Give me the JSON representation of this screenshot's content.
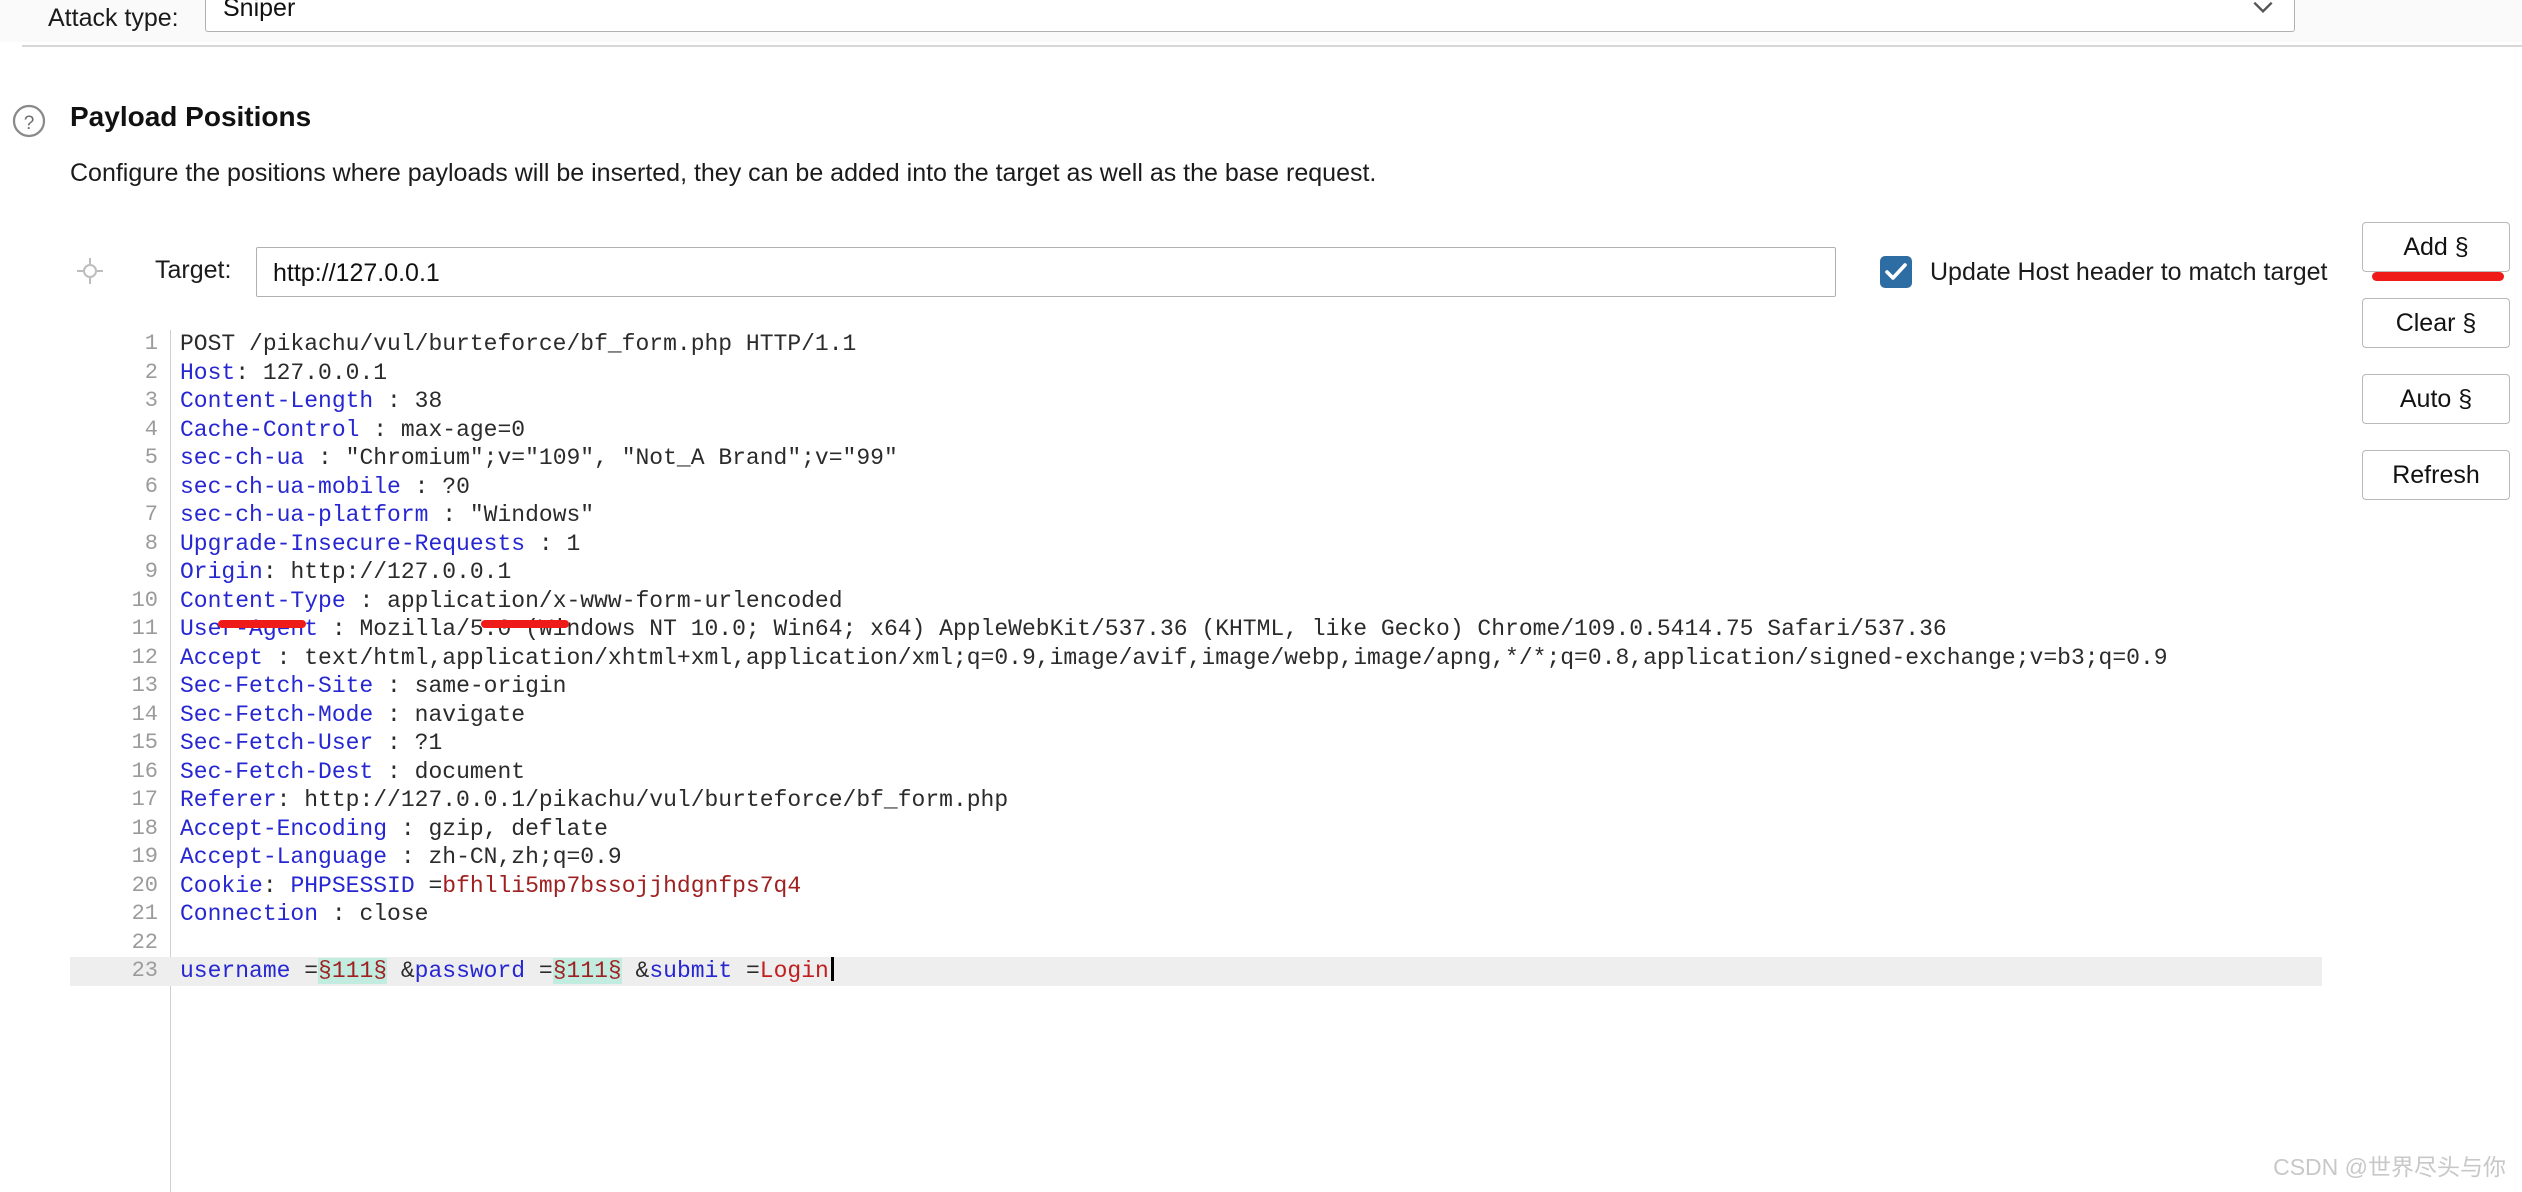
{
  "attack": {
    "label": "Attack type:",
    "selected": "Sniper",
    "chevron_icon": "chevron-down-icon"
  },
  "section": {
    "help_icon": "help-circle-icon",
    "title": "Payload Positions",
    "description": "Configure the positions where payloads will be inserted, they can be added into the target as well as the base request."
  },
  "target": {
    "icon": "crosshair-icon",
    "label": "Target:",
    "value": "http://127.0.0.1",
    "placeholder": ""
  },
  "host_checkbox": {
    "label": "Update Host header to match target",
    "checked": true,
    "color": "#2e6da4"
  },
  "buttons": [
    {
      "label": "Add §",
      "underlined": true
    },
    {
      "label": "Clear §",
      "underlined": false
    },
    {
      "label": "Auto §",
      "underlined": false
    },
    {
      "label": "Refresh",
      "underlined": false
    }
  ],
  "colors": {
    "header_blue": "#2727d2",
    "value_dark": "#2b2b2b",
    "cookie_value_red": "#9e2020",
    "param_value_red": "#c01f1f",
    "payload_marker_bg": "#c3ece0",
    "annotation_red": "#ef1b19",
    "highlight_row": "#eeeeee"
  },
  "editor": {
    "lines": [
      {
        "n": "1",
        "text": "POST  /pikachu/vul/burteforce/bf_form.php     HTTP/1.1"
      },
      {
        "n": "2",
        "text": "Host: 127.0.0.1"
      },
      {
        "n": "3",
        "text": "Content-Length : 38"
      },
      {
        "n": "4",
        "text": "Cache-Control : max-age=0"
      },
      {
        "n": "5",
        "text": "sec-ch-ua : \"Chromium\";v=\"109\",  \"Not_A Brand\";v=\"99\""
      },
      {
        "n": "6",
        "text": "sec-ch-ua-mobile : ?0"
      },
      {
        "n": "7",
        "text": "sec-ch-ua-platform : \"Windows\""
      },
      {
        "n": "8",
        "text": "Upgrade-Insecure-Requests  : 1"
      },
      {
        "n": "9",
        "text": "Origin: http://127.0.0.1"
      },
      {
        "n": "10",
        "text": "Content-Type : application/x-www-form-urlencoded"
      },
      {
        "n": "11",
        "text": "User-Agent : Mozilla/5.0  (Windows  NT 10.0; Win64; x64) AppleWebKit/537.36  (KHTML, like Gecko) Chrome/109.0.5414.75  Safari/537.36"
      },
      {
        "n": "12",
        "text": "Accept : text/html,application/xhtml+xml,application/xml;q=0.9,image/avif,image/webp,image/apng,*/*;q=0.8,application/signed-exchange;v=b3;q=0.9"
      },
      {
        "n": "13",
        "text": "Sec-Fetch-Site : same-origin"
      },
      {
        "n": "14",
        "text": "Sec-Fetch-Mode : navigate"
      },
      {
        "n": "15",
        "text": "Sec-Fetch-User : ?1"
      },
      {
        "n": "16",
        "text": "Sec-Fetch-Dest : document"
      },
      {
        "n": "17",
        "text": "Referer: http://127.0.0.1/pikachu/vul/burteforce/bf_form.php"
      },
      {
        "n": "18",
        "text": "Accept-Encoding : gzip, deflate"
      },
      {
        "n": "19",
        "text": "Accept-Language : zh-CN,zh;q=0.9"
      },
      {
        "n": "20",
        "text": "Cookie: PHPSESSID =bfhlli5mp7bssojjhdgnfps7q4"
      },
      {
        "n": "21",
        "text": "Connection : close"
      },
      {
        "n": "22",
        "text": ""
      },
      {
        "n": "23",
        "text": "username =§111§ &password =§111§ &submit =Login"
      }
    ],
    "line1_parts": {
      "method": "POST",
      "path": " /pikachu/vul/burteforce/bf_form.php",
      "version": "    HTTP/1.1"
    },
    "headers": [
      {
        "n": "2",
        "name": "Host",
        "sep": ": ",
        "value": "127.0.0.1"
      },
      {
        "n": "3",
        "name": "Content-Length",
        "sep": " : ",
        "value": "38"
      },
      {
        "n": "4",
        "name": "Cache-Control",
        "sep": " : ",
        "value": "max-age=0"
      },
      {
        "n": "5",
        "name": "sec-ch-ua",
        "sep": " : ",
        "value": "\"Chromium\";v=\"109\",  \"Not_A Brand\";v=\"99\""
      },
      {
        "n": "6",
        "name": "sec-ch-ua-mobile",
        "sep": " : ",
        "value": "?0"
      },
      {
        "n": "7",
        "name": "sec-ch-ua-platform",
        "sep": " : ",
        "value": "\"Windows\""
      },
      {
        "n": "8",
        "name": "Upgrade-Insecure-Requests",
        "sep": "  : ",
        "value": "1"
      },
      {
        "n": "9",
        "name": "Origin",
        "sep": ": ",
        "value": "http://127.0.0.1"
      },
      {
        "n": "10",
        "name": "Content-Type",
        "sep": " : ",
        "value": "application/x-www-form-urlencoded"
      },
      {
        "n": "11",
        "name": "User-Agent",
        "sep": " : ",
        "value": "Mozilla/5.0  (Windows  NT 10.0; Win64; x64) AppleWebKit/537.36  (KHTML, like Gecko) Chrome/109.0.5414.75  Safari/537.36"
      },
      {
        "n": "12",
        "name": "Accept",
        "sep": " : ",
        "value": "text/html,application/xhtml+xml,application/xml;q=0.9,image/avif,image/webp,image/apng,*/*;q=0.8,application/signed-exchange;v=b3;q=0.9"
      },
      {
        "n": "13",
        "name": "Sec-Fetch-Site",
        "sep": " : ",
        "value": "same-origin"
      },
      {
        "n": "14",
        "name": "Sec-Fetch-Mode",
        "sep": " : ",
        "value": "navigate"
      },
      {
        "n": "15",
        "name": "Sec-Fetch-User",
        "sep": " : ",
        "value": "?1"
      },
      {
        "n": "16",
        "name": "Sec-Fetch-Dest",
        "sep": " : ",
        "value": "document"
      },
      {
        "n": "17",
        "name": "Referer",
        "sep": ": ",
        "value": "http://127.0.0.1/pikachu/vul/burteforce/bf_form.php"
      },
      {
        "n": "18",
        "name": "Accept-Encoding",
        "sep": " : ",
        "value": "gzip, deflate"
      },
      {
        "n": "19",
        "name": "Accept-Language",
        "sep": " : ",
        "value": "zh-CN,zh;q=0.9"
      }
    ],
    "cookie_line": {
      "n": "20",
      "name": "Cookie",
      "sep": ": ",
      "cookie_name": "PHPSESSID ",
      "eq": "=",
      "cookie_value": "bfhlli5mp7bssojjhdgnfps7q4"
    },
    "connection_line": {
      "n": "21",
      "name": "Connection",
      "sep": " : ",
      "value": "close"
    },
    "blank_line": {
      "n": "22",
      "text": ""
    },
    "body_line": {
      "n": "23",
      "p1_name": "username ",
      "p1_eq": "=",
      "p1_marker": "§111§",
      "p2_amp": " &",
      "p2_name": "password ",
      "p2_eq": "=",
      "p2_marker": "§111§",
      "p3_amp": " &",
      "p3_name": "submit ",
      "p3_eq": "=",
      "p3_value": "Login"
    }
  },
  "watermark": "CSDN @世界尽头与你"
}
